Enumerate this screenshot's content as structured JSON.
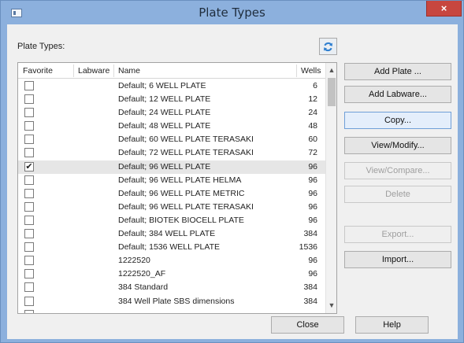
{
  "window": {
    "title": "Plate Types",
    "close_glyph": "×"
  },
  "list_section": {
    "label": "Plate Types:",
    "refresh_icon": "refresh-icon"
  },
  "table": {
    "columns": [
      "Favorite",
      "Labware",
      "Name",
      "Wells"
    ],
    "rows": [
      {
        "favorite": false,
        "name": "Default; 6 WELL PLATE",
        "wells": "6"
      },
      {
        "favorite": false,
        "name": "Default; 12 WELL PLATE",
        "wells": "12"
      },
      {
        "favorite": false,
        "name": "Default; 24 WELL PLATE",
        "wells": "24"
      },
      {
        "favorite": false,
        "name": "Default; 48 WELL PLATE",
        "wells": "48"
      },
      {
        "favorite": false,
        "name": "Default; 60 WELL PLATE TERASAKI",
        "wells": "60"
      },
      {
        "favorite": false,
        "name": "Default; 72 WELL PLATE TERASAKI",
        "wells": "72"
      },
      {
        "favorite": true,
        "name": "Default; 96 WELL PLATE",
        "wells": "96",
        "selected": true
      },
      {
        "favorite": false,
        "name": "Default; 96 WELL PLATE HELMA",
        "wells": "96"
      },
      {
        "favorite": false,
        "name": "Default; 96 WELL PLATE METRIC",
        "wells": "96"
      },
      {
        "favorite": false,
        "name": "Default; 96 WELL PLATE TERASAKI",
        "wells": "96"
      },
      {
        "favorite": false,
        "name": "Default; BIOTEK BIOCELL PLATE",
        "wells": "96"
      },
      {
        "favorite": false,
        "name": "Default; 384 WELL PLATE",
        "wells": "384"
      },
      {
        "favorite": false,
        "name": "Default; 1536 WELL PLATE",
        "wells": "1536"
      },
      {
        "favorite": false,
        "name": "1222520",
        "wells": "96"
      },
      {
        "favorite": false,
        "name": "1222520_AF",
        "wells": "96"
      },
      {
        "favorite": false,
        "name": "384 Standard",
        "wells": "384"
      },
      {
        "favorite": false,
        "name": "384 Well Plate SBS dimensions",
        "wells": "384"
      },
      {
        "favorite": false,
        "name": "",
        "wells": ""
      }
    ],
    "check_glyph": "✔",
    "scroll_up_glyph": "▲",
    "scroll_down_glyph": "▼"
  },
  "side_buttons": {
    "add_plate": "Add Plate ...",
    "add_labware": "Add Labware...",
    "copy": "Copy...",
    "view_modify": "View/Modify...",
    "view_compare": "View/Compare...",
    "delete": "Delete",
    "export": "Export...",
    "import": "Import..."
  },
  "bottom_buttons": {
    "close": "Close",
    "help": "Help"
  },
  "colors": {
    "frame": "#8cb0dd",
    "close_button": "#c7463f",
    "refresh_icon": "#2f7fd0"
  }
}
